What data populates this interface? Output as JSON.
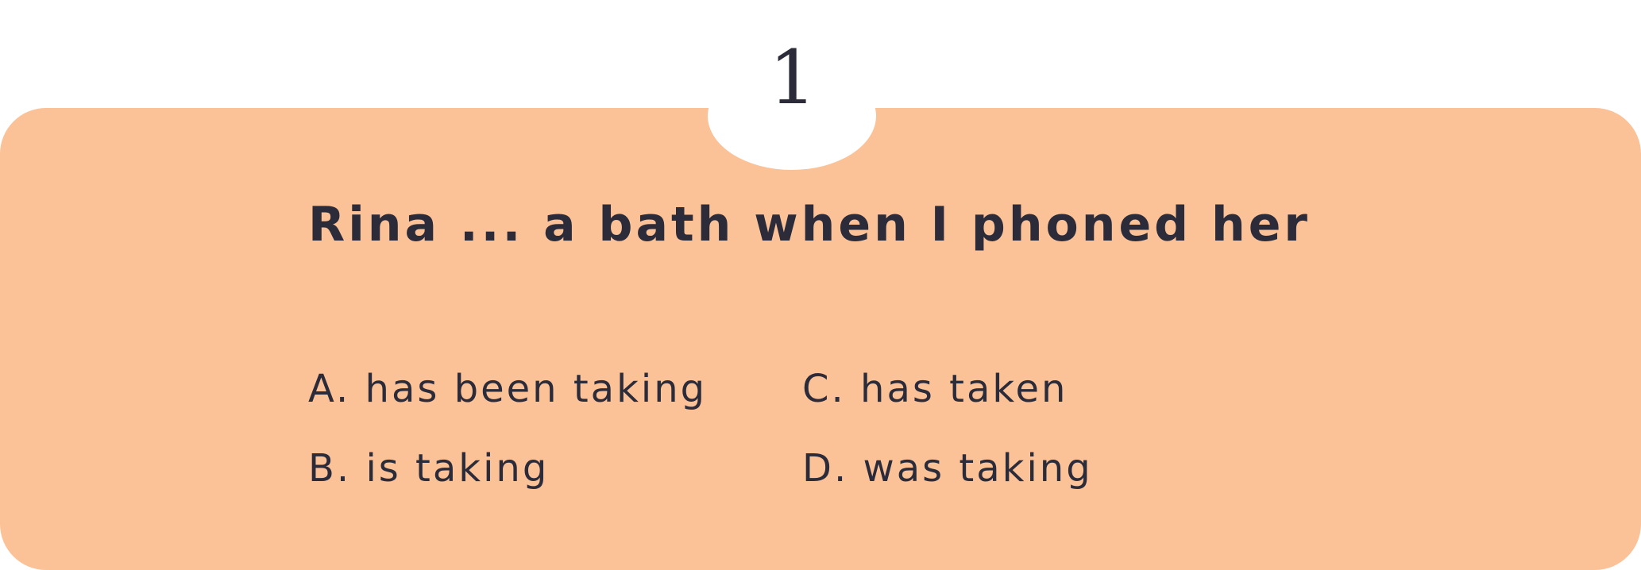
{
  "question_number": "1",
  "question": "Rina ... a bath when I phoned her",
  "options": [
    {
      "letter": "A.",
      "text": "has been taking"
    },
    {
      "letter": "B.",
      "text": "is taking"
    },
    {
      "letter": "C.",
      "text": "has taken"
    },
    {
      "letter": "D.",
      "text": "was taking"
    }
  ],
  "colors": {
    "card_background": "#fbc197",
    "text": "#2b2b3a",
    "page_background": "#ffffff"
  }
}
